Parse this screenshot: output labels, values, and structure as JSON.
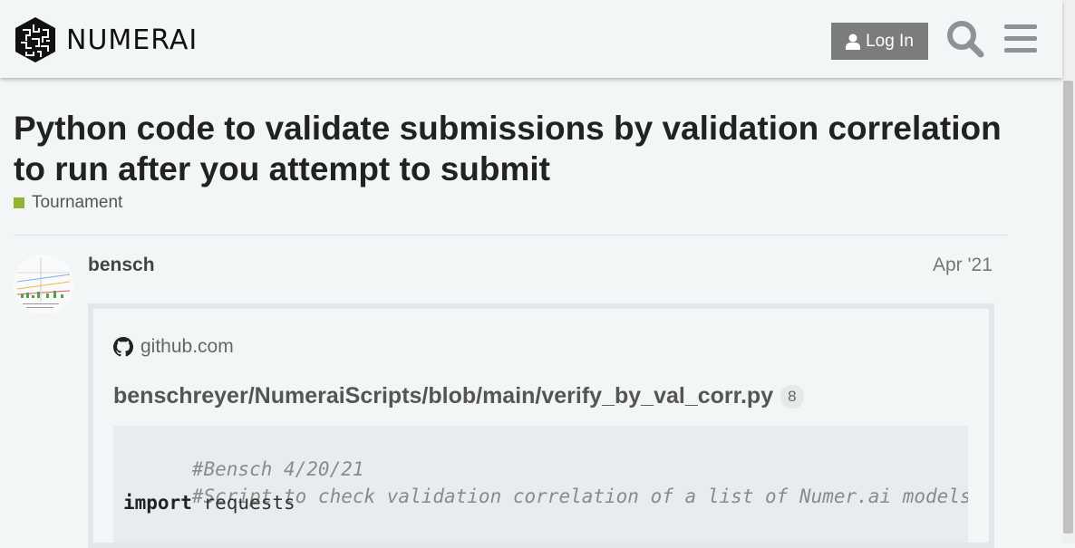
{
  "header": {
    "brand_name": "NUMERAI",
    "login_label": "Log In",
    "icons": [
      "user-icon",
      "search-icon",
      "hamburger-menu-icon"
    ]
  },
  "topic": {
    "title": "Python code to validate submissions by validation correlation to run after you attempt to submit",
    "category": "Tournament",
    "category_color": "#92b334"
  },
  "post": {
    "username": "bensch",
    "date": "Apr '21",
    "onebox": {
      "source": "github.com",
      "repo_path": "benschreyer/NumeraiScripts/blob/main/verify_by_val_corr.py",
      "line_count_badge": "8",
      "code_lines": [
        {
          "comment": "#Bensch 4/20/21"
        },
        {
          "comment": "#Script to check validation correlation of a list of Numer.ai models and"
        },
        {
          "keyword": "import",
          "rest": " requests"
        }
      ]
    }
  }
}
